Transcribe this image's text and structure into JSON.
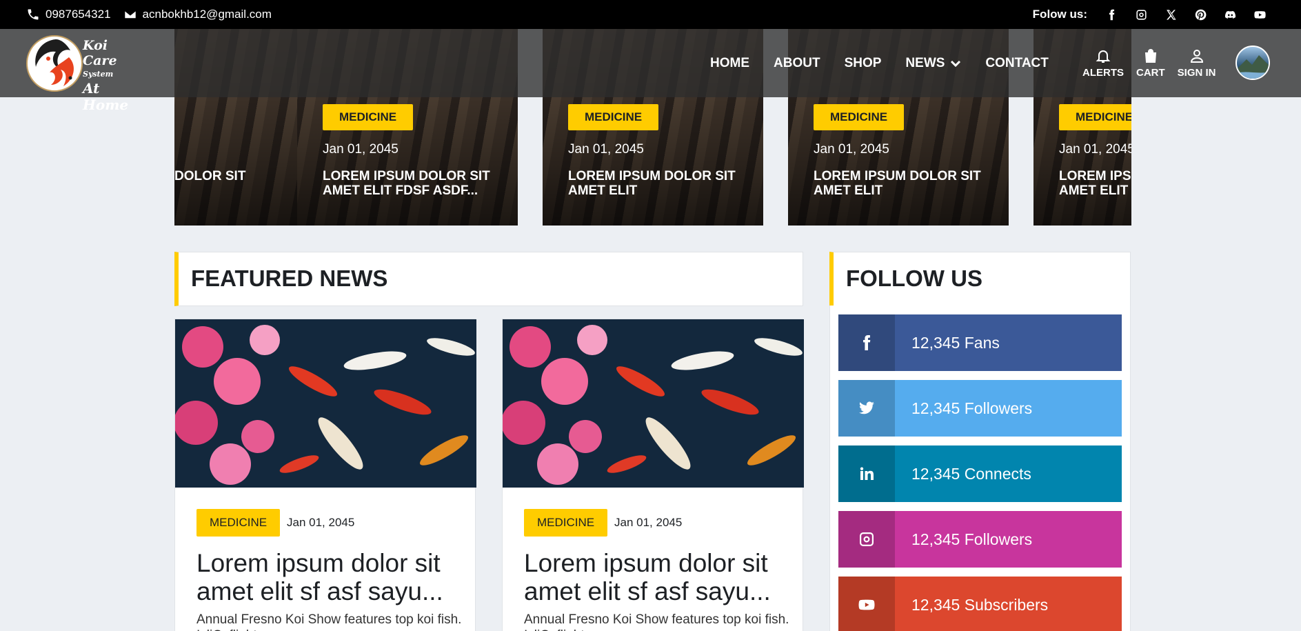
{
  "topbar": {
    "phone": "0987654321",
    "email": "acnbokhb12@gmail.com",
    "follow_label": "Folow us:",
    "socials": [
      "facebook-icon",
      "instagram-icon",
      "x-icon",
      "pinterest-icon",
      "discord-icon",
      "youtube-icon"
    ]
  },
  "logo": {
    "line1": "Koi Care",
    "line2": "System",
    "line3": "At Home"
  },
  "nav": {
    "items": [
      {
        "label": "HOME"
      },
      {
        "label": "ABOUT"
      },
      {
        "label": "SHOP"
      },
      {
        "label": "NEWS"
      },
      {
        "label": "CONTACT"
      }
    ],
    "actions": [
      {
        "label": "ALERTS",
        "icon": "bell-icon"
      },
      {
        "label": "CART",
        "icon": "bag-icon"
      },
      {
        "label": "SIGN IN",
        "icon": "user-icon"
      }
    ]
  },
  "ticker": {
    "slides": [
      {
        "category": "",
        "date": "",
        "title": "DOLOR SIT"
      },
      {
        "category": "MEDICINE",
        "date": "Jan 01, 2045",
        "title": "LOREM IPSUM DOLOR SIT AMET ELIT FDSF ASDF..."
      },
      {
        "category": "MEDICINE",
        "date": "Jan 01, 2045",
        "title": "LOREM IPSUM DOLOR SIT AMET ELIT"
      },
      {
        "category": "MEDICINE",
        "date": "Jan 01, 2045",
        "title": "LOREM IPSUM DOLOR SIT AMET ELIT"
      },
      {
        "category": "MEDICINE",
        "date": "Jan 01, 2045",
        "title": "LOREM IPSUM DOLOR SIT AMET ELIT"
      }
    ]
  },
  "featured": {
    "heading": "FEATURED NEWS",
    "cards": [
      {
        "category": "MEDICINE",
        "date": "Jan 01, 2045",
        "title": "Lorem ipsum dolor sit amet elit sf asf sayu...",
        "excerpt": "Annual Fresno Koi Show features top koi fish. IcliC..flight..."
      },
      {
        "category": "MEDICINE",
        "date": "Jan 01, 2045",
        "title": "Lorem ipsum dolor sit amet elit sf asf sayu...",
        "excerpt": "Annual Fresno Koi Show features top koi fish. IcliC..flight..."
      }
    ]
  },
  "follow": {
    "heading": "FOLLOW US",
    "rows": [
      {
        "icon": "facebook-icon",
        "label": "12,345 Fans",
        "color": "#3b5998"
      },
      {
        "icon": "twitter-icon",
        "label": "12,345 Followers",
        "color": "#55acee"
      },
      {
        "icon": "linkedin-icon",
        "label": "12,345 Connects",
        "color": "#0185ae"
      },
      {
        "icon": "instagram-icon",
        "label": "12,345 Followers",
        "color": "#c8359d"
      },
      {
        "icon": "youtube-icon",
        "label": "12,345 Subscribers",
        "color": "#dc472e"
      }
    ]
  }
}
